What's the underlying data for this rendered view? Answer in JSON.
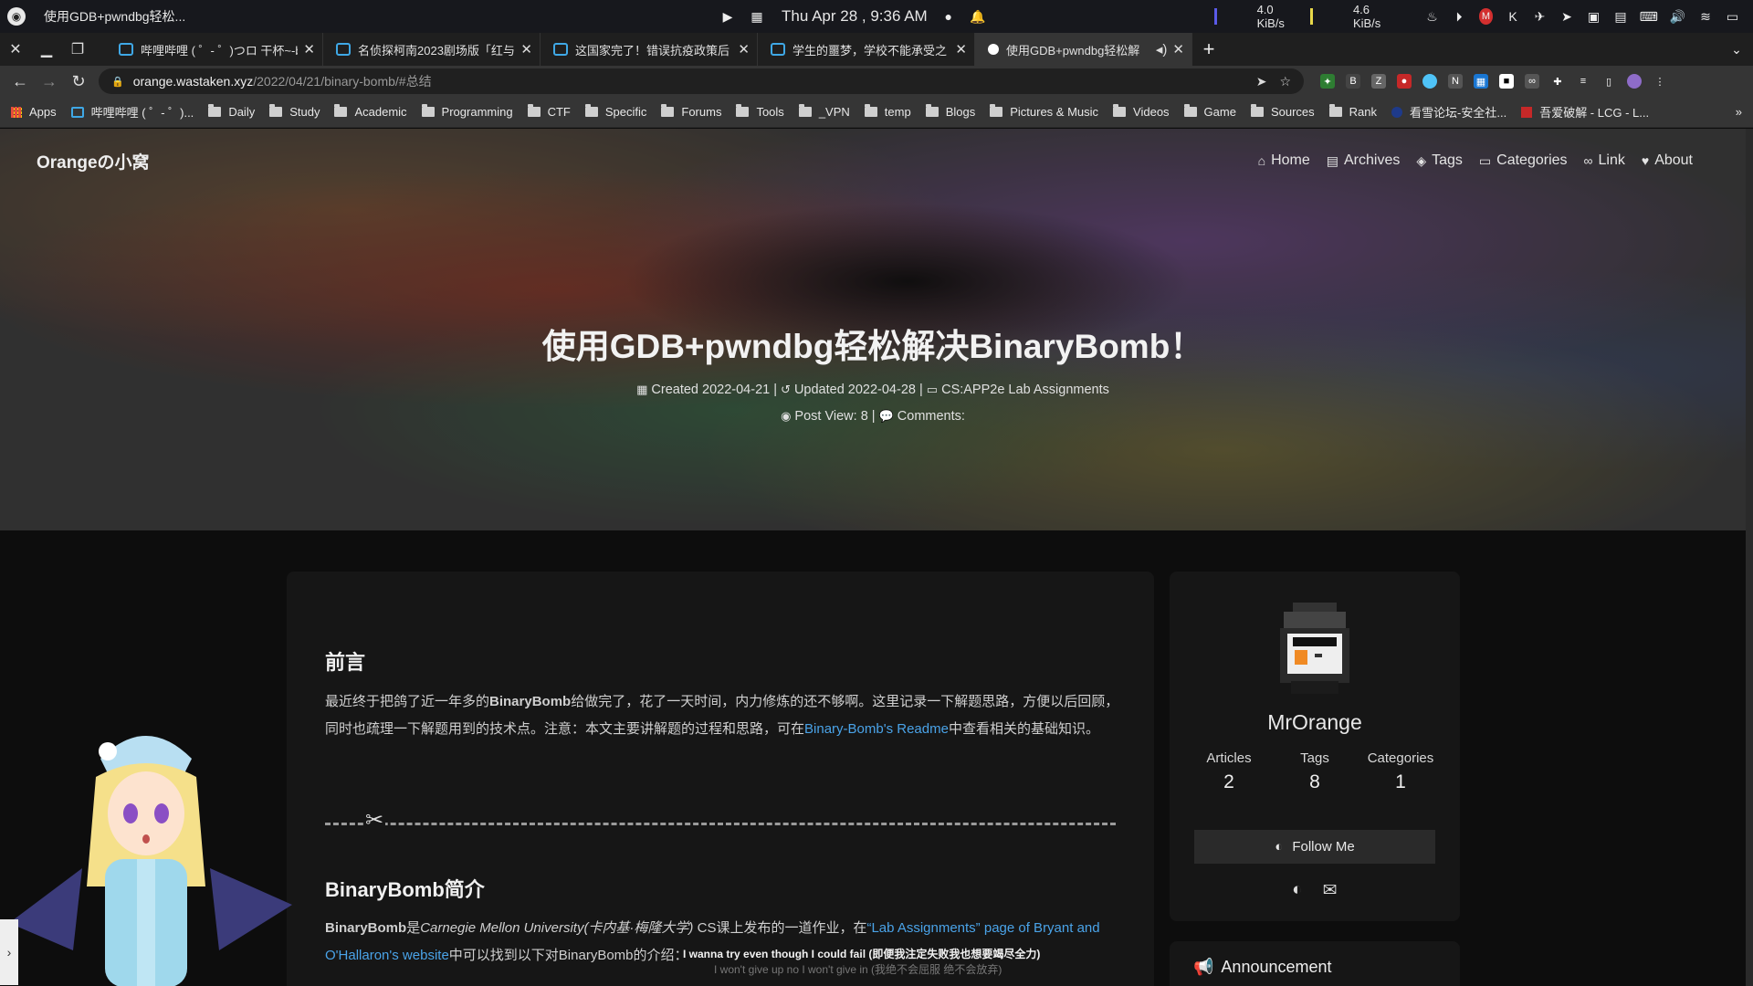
{
  "system_bar": {
    "window_title": "使用GDB+pwndbg轻松...",
    "clock": "Thu Apr 28 , 9:36 AM",
    "net_down": "4.0 KiB/s",
    "net_up": "4.6 KiB/s"
  },
  "tabs": [
    {
      "title": "哔哩哔哩 ( ゜- ゜)つロ 干杯~-bili",
      "active": false
    },
    {
      "title": "名侦探柯南2023剧场版「红与",
      "active": false
    },
    {
      "title": "这国家完了！错误抗疫政策后",
      "active": false
    },
    {
      "title": "学生的噩梦，学校不能承受之",
      "active": false
    },
    {
      "title": "使用GDB+pwndbg轻松解",
      "active": true
    }
  ],
  "address": {
    "host": "orange.wastaken.xyz",
    "path": "/2022/04/21/binary-bomb/#总结"
  },
  "bookmarks": [
    {
      "label": "Apps",
      "type": "apps"
    },
    {
      "label": "哔哩哔哩 ( ゜- ゜)...",
      "type": "site"
    },
    {
      "label": "Daily",
      "type": "folder"
    },
    {
      "label": "Study",
      "type": "folder"
    },
    {
      "label": "Academic",
      "type": "folder"
    },
    {
      "label": "Programming",
      "type": "folder"
    },
    {
      "label": "CTF",
      "type": "folder"
    },
    {
      "label": "Specific",
      "type": "folder"
    },
    {
      "label": "Forums",
      "type": "folder"
    },
    {
      "label": "Tools",
      "type": "folder"
    },
    {
      "label": "_VPN",
      "type": "folder"
    },
    {
      "label": "temp",
      "type": "folder"
    },
    {
      "label": "Blogs",
      "type": "folder"
    },
    {
      "label": "Pictures & Music",
      "type": "folder"
    },
    {
      "label": "Videos",
      "type": "folder"
    },
    {
      "label": "Game",
      "type": "folder"
    },
    {
      "label": "Sources",
      "type": "folder"
    },
    {
      "label": "Rank",
      "type": "folder"
    },
    {
      "label": "看雪论坛-安全社...",
      "type": "site"
    },
    {
      "label": "吾爱破解 - LCG - L...",
      "type": "site"
    }
  ],
  "site": {
    "name": "Orangeの小窝",
    "menu": [
      "Home",
      "Archives",
      "Tags",
      "Categories",
      "Link",
      "About"
    ]
  },
  "post": {
    "title": "使用GDB+pwndbg轻松解决BinaryBomb！",
    "created": "Created 2022-04-21",
    "updated": "Updated 2022-04-28",
    "category": "CS:APP2e Lab Assignments",
    "views": "Post View: 8",
    "comments": "Comments:"
  },
  "article": {
    "h_intro": "前言",
    "intro_a": "最近终于把鸽了近一年多的",
    "intro_bold": "BinaryBomb",
    "intro_b": "给做完了，花了一天时间，内力修炼的还不够啊。这里记录一下解题思路，方便以后回顾，同时也疏理一下解题用到的技术点。注意：本文主要讲解题的过程和思路，可在",
    "intro_link": "Binary-Bomb's Readme",
    "intro_c": "中查看相关的基础知识。",
    "h_about": "BinaryBomb简介",
    "about_bold": "BinaryBomb",
    "about_a": "是",
    "about_italic": "Carnegie Mellon University(卡内基·梅隆大学)",
    "about_b": " CS课上发布的一道作业，在",
    "about_link": "“Lab Assignments” page of Bryant and O'Hallaron's website",
    "about_c": "中可以找到以下对BinaryBomb的介绍："
  },
  "profile": {
    "name": "MrOrange",
    "stats": [
      {
        "label": "Articles",
        "value": "2"
      },
      {
        "label": "Tags",
        "value": "8"
      },
      {
        "label": "Categories",
        "value": "1"
      }
    ],
    "follow": "Follow Me"
  },
  "announcement": {
    "title": "Announcement"
  },
  "lyrics": {
    "line1": "I wanna try even though I could fail (即便我注定失败我也想要竭尽全力)",
    "line2": "I won't give up no I won't give in (我绝不会屈服 绝不会放弃)"
  }
}
